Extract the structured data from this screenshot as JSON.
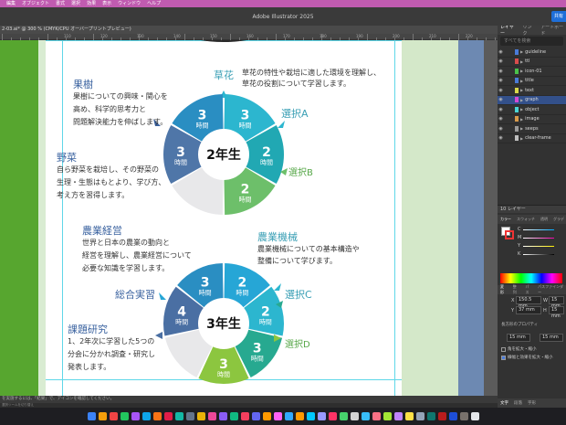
{
  "menubar": {
    "items": [
      "編集",
      "オブジェクト",
      "書式",
      "選択",
      "効果",
      "表示",
      "ウィンドウ",
      "ヘルプ"
    ]
  },
  "window": {
    "title": "Adobe Illustrator 2025",
    "share_label": "共有"
  },
  "document_tab": {
    "label": "2-03.ai* @ 300 % (CMYK/CPU オーバープリントプレビュー)"
  },
  "ruler": {
    "numbers": [
      "110",
      "120",
      "130",
      "140",
      "150",
      "160",
      "170",
      "180",
      "190",
      "200",
      "210",
      "220"
    ]
  },
  "artwork": {
    "top_right_text": {
      "heading": "草花",
      "body": [
        "草花の特性や栽培に適した環境を理解し、",
        "草花の役割について学習します。"
      ]
    },
    "fruit": {
      "heading": "果樹",
      "body": [
        "果樹についての興味・関心を",
        "高め、科学的思考力と",
        "問題解決能力を伸ばします。"
      ]
    },
    "veg": {
      "heading": "野菜",
      "body": [
        "自ら野菜を栽培し、その野菜の",
        "生理・生態はもとより、学び方、",
        "考え方を習得します。"
      ]
    },
    "grade2": {
      "center": "2年生",
      "label_a": "選択A",
      "label_b": "選択B",
      "segments": [
        {
          "num": "3",
          "unit": "時間",
          "color": "#2cb6cf"
        },
        {
          "num": "2",
          "unit": "時間",
          "color": "#21a8b3"
        },
        {
          "num": "2",
          "unit": "時間",
          "color": "#6dbf6a"
        },
        {
          "num": "",
          "unit": "",
          "color": "#e8e8ea"
        },
        {
          "num": "3",
          "unit": "時間",
          "color": "#4f76a8"
        },
        {
          "num": "3",
          "unit": "時間",
          "color": "#2a8ec2"
        }
      ]
    },
    "mgmt": {
      "heading": "農業経営",
      "body": [
        "世界と日本の農業の動向と",
        "経営を理解し、農業経営について",
        "必要な知識を学習します。"
      ]
    },
    "machinery": {
      "heading": "農業機械",
      "body": [
        "農業機械についての基本構造や",
        "整備について学びます。"
      ]
    },
    "comprehensive": {
      "heading": "総合実習"
    },
    "research": {
      "heading": "課題研究",
      "body": [
        "1、2年次に学習した5つの",
        "分会に分かれ調査・研究し",
        "発表します。"
      ]
    },
    "grade3": {
      "center": "3年生",
      "label_c": "選択C",
      "label_d": "選択D",
      "segments": [
        {
          "num": "2",
          "unit": "時間",
          "color": "#26a6d6"
        },
        {
          "num": "2",
          "unit": "時間",
          "color": "#2cb6cf"
        },
        {
          "num": "3",
          "unit": "時間",
          "color": "#27a990"
        },
        {
          "num": "3",
          "unit": "時間",
          "color": "#8cc63f"
        },
        {
          "num": "",
          "unit": "",
          "color": "#e8e8ea"
        },
        {
          "num": "4",
          "unit": "時間",
          "color": "#4a6fa3"
        },
        {
          "num": "3",
          "unit": "時間",
          "color": "#2a8ec2"
        }
      ]
    }
  },
  "statusbar": {
    "hint": "を実施するには、「結果」で、アイコンを確認してください。",
    "sub": "選択ツールを切り替え"
  },
  "layers_panel": {
    "tabs": [
      "レイヤー",
      "リンク",
      "アートボード"
    ],
    "search_placeholder": "すべてを検索",
    "layers": [
      {
        "name": "guideline",
        "color": "#4a7bd8",
        "selected": false
      },
      {
        "name": "ttl",
        "color": "#d94c4c",
        "selected": false
      },
      {
        "name": "icon-01",
        "color": "#4ac24a",
        "selected": false
      },
      {
        "name": "title",
        "color": "#4a7bd8",
        "selected": false
      },
      {
        "name": "text",
        "color": "#d8d84a",
        "selected": false
      },
      {
        "name": "graph",
        "color": "#d44ad4",
        "selected": true
      },
      {
        "name": "object",
        "color": "#4ad4d4",
        "selected": false
      },
      {
        "name": "image",
        "color": "#d89a4a",
        "selected": false
      },
      {
        "name": "seeps",
        "color": "#9a9a9a",
        "selected": false
      },
      {
        "name": "clear-frame",
        "color": "#c0c0c0",
        "selected": false
      }
    ],
    "layer_count": "10 レイヤー"
  },
  "color_panel": {
    "tabs": [
      "カラー",
      "スウォッチ",
      "透明",
      "グラデ"
    ],
    "channels": [
      "C",
      "M",
      "Y",
      "K"
    ]
  },
  "transform_panel": {
    "tabs": [
      "変形",
      "整列",
      "パス",
      "パスファインダー"
    ],
    "x_label": "X",
    "x_value": "150.5 mm",
    "y_label": "Y",
    "y_value": "37 mm",
    "w_label": "W",
    "w_value": "15 mm",
    "h_label": "H",
    "h_value": "15 mm",
    "section_label": "長方形のプロパティ",
    "corner1": "15 mm",
    "corner2": "15 mm",
    "opt1": "角を拡大・縮小",
    "opt2": "線幅と効果を拡大・縮小"
  },
  "properties_tabs": [
    "文字",
    "段落",
    "字形"
  ]
}
